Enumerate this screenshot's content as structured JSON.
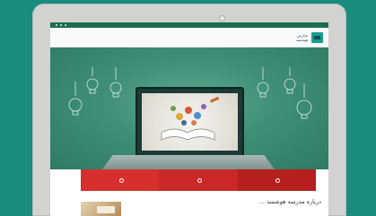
{
  "topbar": {
    "site_name": ""
  },
  "nav": {
    "items": [
      {
        "label": ""
      },
      {
        "label": ""
      },
      {
        "label": ""
      },
      {
        "label": ""
      },
      {
        "label": ""
      },
      {
        "label": ""
      },
      {
        "label": ""
      }
    ]
  },
  "brand": {
    "line1": "مدارس",
    "line2": "هوشمند"
  },
  "features": [
    {
      "label": ""
    },
    {
      "label": ""
    },
    {
      "label": ""
    }
  ],
  "section": {
    "title": "درباره مدرسه هوشمند ..."
  },
  "colors": {
    "background": "#1a8c7e",
    "hero": "#3f8f76",
    "accent": "#d62f2d",
    "topbar": "#1d6d4f"
  }
}
